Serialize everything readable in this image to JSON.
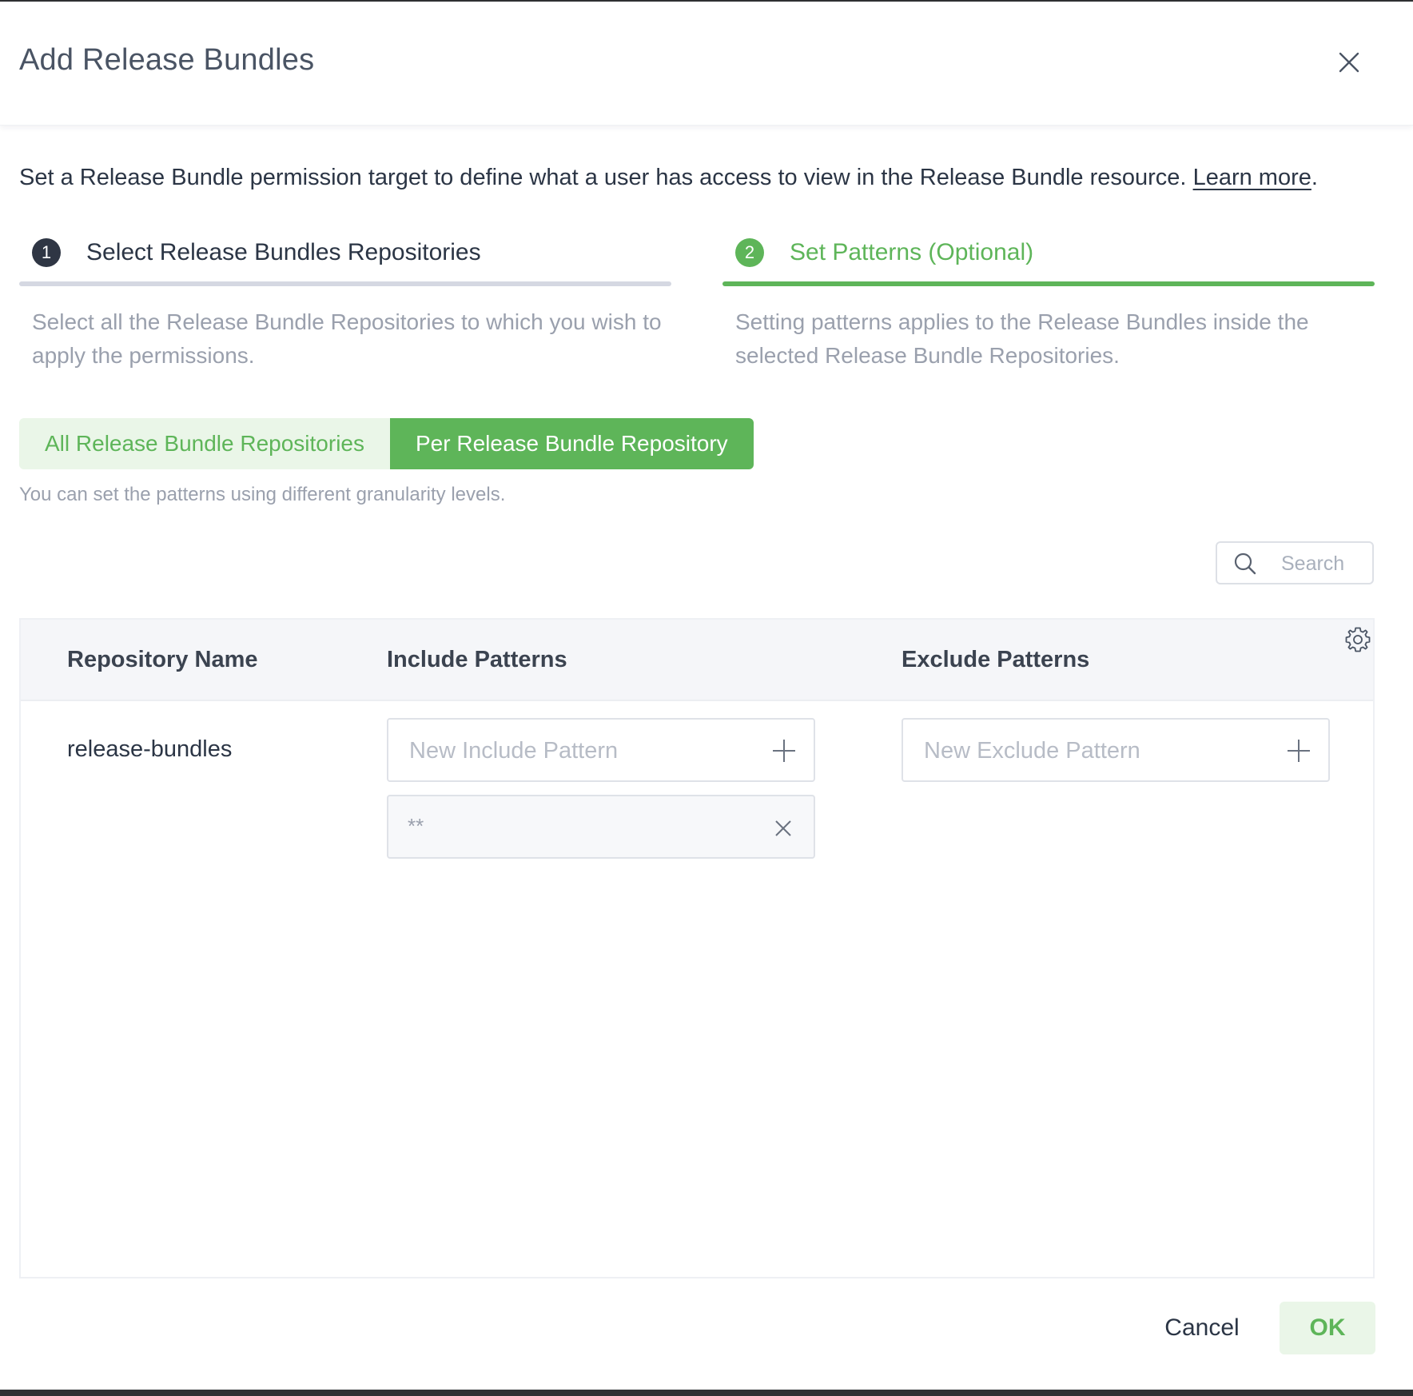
{
  "dialog": {
    "title": "Add Release Bundles"
  },
  "intro": {
    "text": "Set a Release Bundle permission target to define what a user has access to view in the Release Bundle resource.",
    "link_label": "Learn more",
    "suffix": "."
  },
  "steps": [
    {
      "number": "1",
      "title": "Select Release Bundles Repositories",
      "description": "Select all the Release Bundle Repositories to which you wish to apply the permissions.",
      "active": false
    },
    {
      "number": "2",
      "title": "Set Patterns (Optional)",
      "description": "Setting patterns applies to the Release Bundles inside the selected Release Bundle Repositories.",
      "active": true
    }
  ],
  "mode_toggle": {
    "options": [
      "All Release Bundle Repositories",
      "Per Release Bundle Repository"
    ],
    "selected": "Per Release Bundle Repository",
    "hint": "You can set the patterns using different granularity levels."
  },
  "search": {
    "placeholder": "Search",
    "icon": "search-icon"
  },
  "table": {
    "columns": [
      "Repository Name",
      "Include Patterns",
      "Exclude Patterns"
    ],
    "settings_icon": "gear-icon",
    "rows": [
      {
        "repository": "release-bundles",
        "include_placeholder": "New Include Pattern",
        "include_patterns": [
          "**"
        ],
        "exclude_placeholder": "New Exclude Pattern",
        "exclude_patterns": []
      }
    ]
  },
  "footer": {
    "cancel_label": "Cancel",
    "ok_label": "OK"
  },
  "colors": {
    "accent_green": "#5eb559",
    "accent_green_light": "#eaf6e8",
    "step_inactive_bar": "#d5d8e2",
    "step_inactive_badge": "#2f3644",
    "text_dark": "#2b3545",
    "text_muted": "#9aa0ad"
  }
}
